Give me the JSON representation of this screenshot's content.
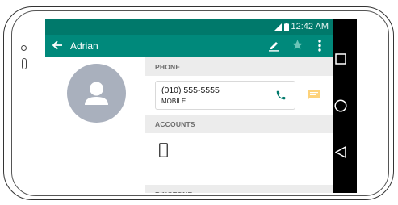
{
  "status_bar": {
    "time": "12:42 AM"
  },
  "app_bar": {
    "contact_name": "Adrian"
  },
  "sections": {
    "phone": {
      "header": "PHONE",
      "number": "(010) 555-5555",
      "type": "MOBILE"
    },
    "accounts": {
      "header": "ACCOUNTS"
    },
    "ringtone": {
      "header": "RINGTONE"
    }
  },
  "icons": {
    "status": [
      "signal-icon",
      "battery-icon"
    ],
    "app_bar": [
      "back-arrow-icon",
      "edit-icon",
      "star-icon",
      "more-vert-icon"
    ],
    "content": [
      "avatar-person-icon",
      "call-icon",
      "message-icon",
      "device-account-icon"
    ],
    "nav": [
      "recent-apps-icon",
      "home-icon",
      "back-nav-icon"
    ]
  },
  "colors": {
    "primary": "#00897b",
    "primary_dark": "#00796b",
    "call_icon": "#00796b",
    "message_icon": "#fdd27a",
    "avatar_bg": "#a9b0bd",
    "section_header_bg": "#ececec",
    "nav_bar": "#000000"
  }
}
